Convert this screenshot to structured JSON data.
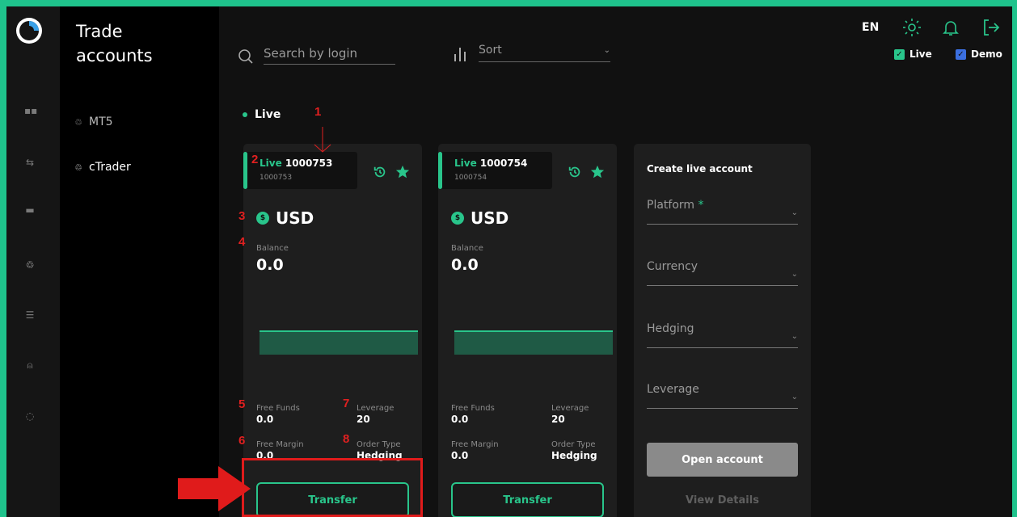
{
  "sidebar": {
    "title_line1": "Trade",
    "title_line2": "accounts",
    "items": [
      {
        "label": "MT5"
      },
      {
        "label": "cTrader"
      }
    ]
  },
  "toolbar": {
    "search_placeholder": "Search by login",
    "sort_label": "Sort"
  },
  "header": {
    "language": "EN",
    "live_filter": "Live",
    "demo_filter": "Demo"
  },
  "section": {
    "label": "Live"
  },
  "cards": [
    {
      "type": "Live",
      "number": "1000753",
      "sub": "1000753",
      "currency": "USD",
      "balance_label": "Balance",
      "balance": "0.0",
      "free_funds_label": "Free Funds",
      "free_funds": "0.0",
      "leverage_label": "Leverage",
      "leverage": "20",
      "free_margin_label": "Free Margin",
      "free_margin": "0.0",
      "order_type_label": "Order Type",
      "order_type": "Hedging",
      "button": "Transfer"
    },
    {
      "type": "Live",
      "number": "1000754",
      "sub": "1000754",
      "currency": "USD",
      "balance_label": "Balance",
      "balance": "0.0",
      "free_funds_label": "Free Funds",
      "free_funds": "0.0",
      "leverage_label": "Leverage",
      "leverage": "20",
      "free_margin_label": "Free Margin",
      "free_margin": "0.0",
      "order_type_label": "Order Type",
      "order_type": "Hedging",
      "button": "Transfer"
    }
  ],
  "create": {
    "title": "Create live account",
    "platform": "Platform",
    "required_mark": "*",
    "currency": "Currency",
    "hedging": "Hedging",
    "leverage": "Leverage",
    "open_button": "Open account",
    "view_details": "View Details"
  },
  "annotations": [
    "1",
    "2",
    "3",
    "4",
    "5",
    "6",
    "7",
    "8"
  ],
  "colors": {
    "accent": "#29c58b",
    "frame": "#1fc38c",
    "annotation": "#e02020",
    "checkbox": "#29c58b",
    "checkbox_demo": "#3b6fe0"
  }
}
